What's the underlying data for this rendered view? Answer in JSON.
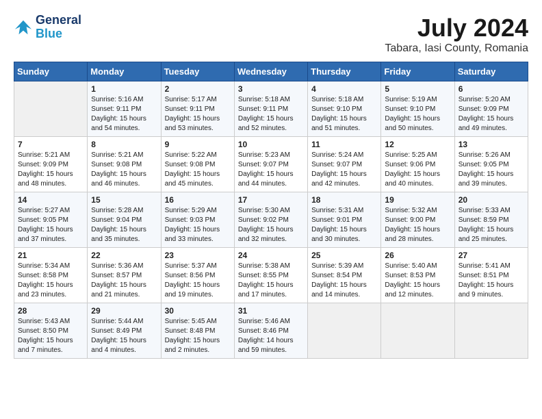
{
  "logo": {
    "line1": "General",
    "line2": "Blue"
  },
  "title": "July 2024",
  "subtitle": "Tabara, Iasi County, Romania",
  "headers": [
    "Sunday",
    "Monday",
    "Tuesday",
    "Wednesday",
    "Thursday",
    "Friday",
    "Saturday"
  ],
  "weeks": [
    [
      {
        "day": "",
        "info": ""
      },
      {
        "day": "1",
        "info": "Sunrise: 5:16 AM\nSunset: 9:11 PM\nDaylight: 15 hours\nand 54 minutes."
      },
      {
        "day": "2",
        "info": "Sunrise: 5:17 AM\nSunset: 9:11 PM\nDaylight: 15 hours\nand 53 minutes."
      },
      {
        "day": "3",
        "info": "Sunrise: 5:18 AM\nSunset: 9:11 PM\nDaylight: 15 hours\nand 52 minutes."
      },
      {
        "day": "4",
        "info": "Sunrise: 5:18 AM\nSunset: 9:10 PM\nDaylight: 15 hours\nand 51 minutes."
      },
      {
        "day": "5",
        "info": "Sunrise: 5:19 AM\nSunset: 9:10 PM\nDaylight: 15 hours\nand 50 minutes."
      },
      {
        "day": "6",
        "info": "Sunrise: 5:20 AM\nSunset: 9:09 PM\nDaylight: 15 hours\nand 49 minutes."
      }
    ],
    [
      {
        "day": "7",
        "info": "Sunrise: 5:21 AM\nSunset: 9:09 PM\nDaylight: 15 hours\nand 48 minutes."
      },
      {
        "day": "8",
        "info": "Sunrise: 5:21 AM\nSunset: 9:08 PM\nDaylight: 15 hours\nand 46 minutes."
      },
      {
        "day": "9",
        "info": "Sunrise: 5:22 AM\nSunset: 9:08 PM\nDaylight: 15 hours\nand 45 minutes."
      },
      {
        "day": "10",
        "info": "Sunrise: 5:23 AM\nSunset: 9:07 PM\nDaylight: 15 hours\nand 44 minutes."
      },
      {
        "day": "11",
        "info": "Sunrise: 5:24 AM\nSunset: 9:07 PM\nDaylight: 15 hours\nand 42 minutes."
      },
      {
        "day": "12",
        "info": "Sunrise: 5:25 AM\nSunset: 9:06 PM\nDaylight: 15 hours\nand 40 minutes."
      },
      {
        "day": "13",
        "info": "Sunrise: 5:26 AM\nSunset: 9:05 PM\nDaylight: 15 hours\nand 39 minutes."
      }
    ],
    [
      {
        "day": "14",
        "info": "Sunrise: 5:27 AM\nSunset: 9:05 PM\nDaylight: 15 hours\nand 37 minutes."
      },
      {
        "day": "15",
        "info": "Sunrise: 5:28 AM\nSunset: 9:04 PM\nDaylight: 15 hours\nand 35 minutes."
      },
      {
        "day": "16",
        "info": "Sunrise: 5:29 AM\nSunset: 9:03 PM\nDaylight: 15 hours\nand 33 minutes."
      },
      {
        "day": "17",
        "info": "Sunrise: 5:30 AM\nSunset: 9:02 PM\nDaylight: 15 hours\nand 32 minutes."
      },
      {
        "day": "18",
        "info": "Sunrise: 5:31 AM\nSunset: 9:01 PM\nDaylight: 15 hours\nand 30 minutes."
      },
      {
        "day": "19",
        "info": "Sunrise: 5:32 AM\nSunset: 9:00 PM\nDaylight: 15 hours\nand 28 minutes."
      },
      {
        "day": "20",
        "info": "Sunrise: 5:33 AM\nSunset: 8:59 PM\nDaylight: 15 hours\nand 25 minutes."
      }
    ],
    [
      {
        "day": "21",
        "info": "Sunrise: 5:34 AM\nSunset: 8:58 PM\nDaylight: 15 hours\nand 23 minutes."
      },
      {
        "day": "22",
        "info": "Sunrise: 5:36 AM\nSunset: 8:57 PM\nDaylight: 15 hours\nand 21 minutes."
      },
      {
        "day": "23",
        "info": "Sunrise: 5:37 AM\nSunset: 8:56 PM\nDaylight: 15 hours\nand 19 minutes."
      },
      {
        "day": "24",
        "info": "Sunrise: 5:38 AM\nSunset: 8:55 PM\nDaylight: 15 hours\nand 17 minutes."
      },
      {
        "day": "25",
        "info": "Sunrise: 5:39 AM\nSunset: 8:54 PM\nDaylight: 15 hours\nand 14 minutes."
      },
      {
        "day": "26",
        "info": "Sunrise: 5:40 AM\nSunset: 8:53 PM\nDaylight: 15 hours\nand 12 minutes."
      },
      {
        "day": "27",
        "info": "Sunrise: 5:41 AM\nSunset: 8:51 PM\nDaylight: 15 hours\nand 9 minutes."
      }
    ],
    [
      {
        "day": "28",
        "info": "Sunrise: 5:43 AM\nSunset: 8:50 PM\nDaylight: 15 hours\nand 7 minutes."
      },
      {
        "day": "29",
        "info": "Sunrise: 5:44 AM\nSunset: 8:49 PM\nDaylight: 15 hours\nand 4 minutes."
      },
      {
        "day": "30",
        "info": "Sunrise: 5:45 AM\nSunset: 8:48 PM\nDaylight: 15 hours\nand 2 minutes."
      },
      {
        "day": "31",
        "info": "Sunrise: 5:46 AM\nSunset: 8:46 PM\nDaylight: 14 hours\nand 59 minutes."
      },
      {
        "day": "",
        "info": ""
      },
      {
        "day": "",
        "info": ""
      },
      {
        "day": "",
        "info": ""
      }
    ]
  ]
}
